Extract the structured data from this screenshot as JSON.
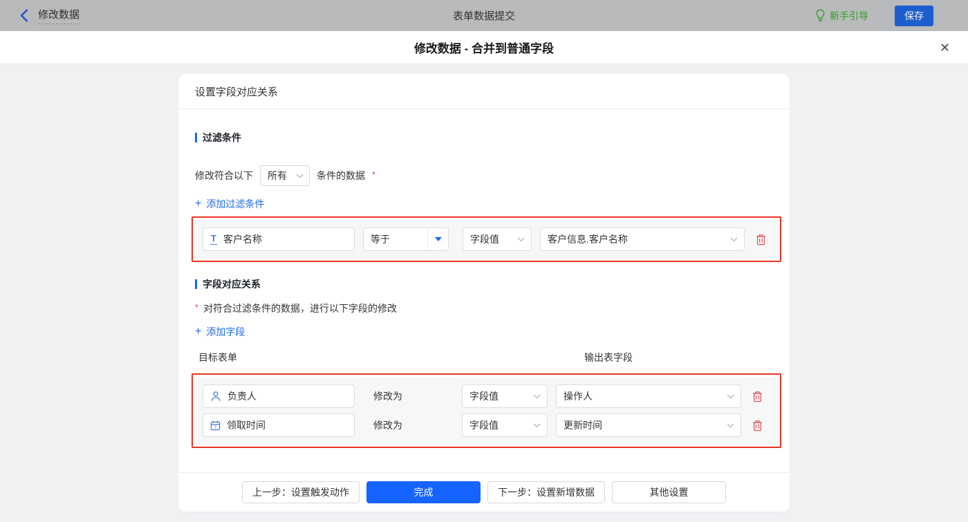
{
  "topbar": {
    "back_label": "修改数据",
    "center_title": "表单数据提交",
    "guide_label": "新手引导",
    "save_label": "保存"
  },
  "modal": {
    "title": "修改数据 - 合并到普通字段",
    "close_glyph": "✕"
  },
  "icons": {
    "plus": "+",
    "text_field_glyph": "T"
  },
  "card": {
    "title": "设置字段对应关系",
    "filter_section": {
      "heading": "过滤条件",
      "condition_prefix": "修改符合以下",
      "condition_scope": "所有",
      "condition_suffix": "条件的数据",
      "required_mark": "*",
      "add_link_label": "添加过滤条件",
      "row": {
        "field": "客户名称",
        "operator": "等于",
        "value_type": "字段值",
        "value": "客户信息.客户名称"
      }
    },
    "mapping_section": {
      "heading": "字段对应关系",
      "required_mark": "*",
      "description": "对符合过滤条件的数据，进行以下字段的修改",
      "add_link_label": "添加字段",
      "columns": {
        "target": "目标表单",
        "output": "输出表字段"
      },
      "rows": [
        {
          "field": "负责人",
          "modify_label": "修改为",
          "value_type": "字段值",
          "value": "操作人"
        },
        {
          "field": "领取时间",
          "modify_label": "修改为",
          "value_type": "字段值",
          "value": "更新时间"
        }
      ]
    },
    "footer": {
      "prev_label": "上一步：设置触发动作",
      "done_label": "完成",
      "next_label": "下一步：设置新增数据",
      "other_label": "其他设置"
    }
  },
  "colors": {
    "brand_blue": "#1664ff",
    "link_blue": "#1d69e8",
    "highlight_red": "#e8331f",
    "danger_red": "#e34d59",
    "field_icon_blue": "#4a77dd",
    "guide_green": "#2e9f23"
  }
}
